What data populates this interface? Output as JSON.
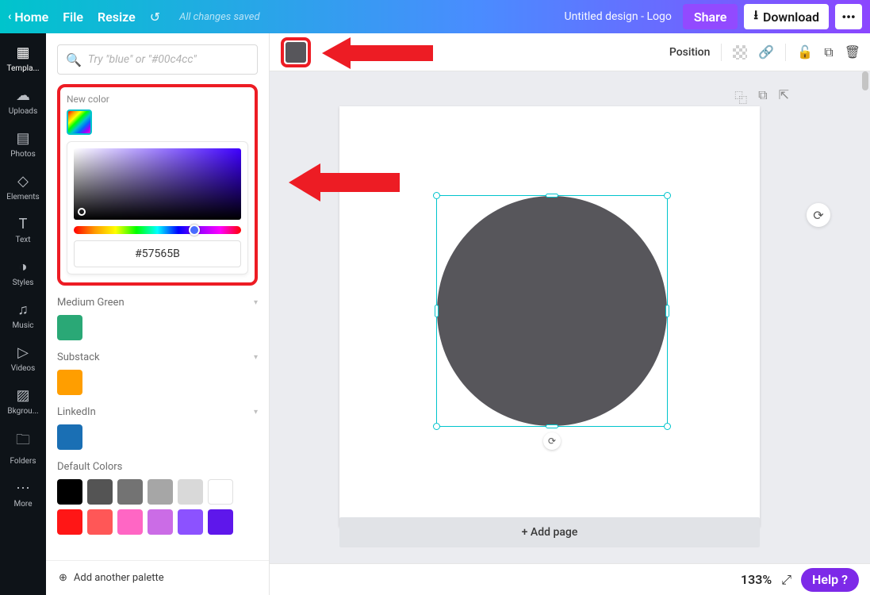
{
  "topbar": {
    "home": "Home",
    "file": "File",
    "resize": "Resize",
    "status": "All changes saved",
    "title": "Untitled design - Logo",
    "share": "Share",
    "download": "Download",
    "more": "•••"
  },
  "rail": {
    "items": [
      {
        "icon": "▦",
        "label": "Templa..."
      },
      {
        "icon": "☁",
        "label": "Uploads"
      },
      {
        "icon": "▤",
        "label": "Photos"
      },
      {
        "icon": "◇",
        "label": "Elements"
      },
      {
        "icon": "T",
        "label": "Text"
      },
      {
        "icon": "◑",
        "label": "Styles"
      },
      {
        "icon": "♫",
        "label": "Music"
      },
      {
        "icon": "▷",
        "label": "Videos"
      },
      {
        "icon": "▨",
        "label": "Bkgrou..."
      },
      {
        "icon": "🗀",
        "label": "Folders"
      },
      {
        "icon": "⋯",
        "label": "More"
      }
    ]
  },
  "panel": {
    "search_placeholder": "Try \"blue\" or \"#00c4cc\"",
    "new_color_label": "New color",
    "hex_value": "#57565B",
    "palettes": [
      {
        "title": "Medium Green",
        "colors": [
          "#2aa876"
        ]
      },
      {
        "title": "Substack",
        "colors": [
          "#ff9e00"
        ]
      },
      {
        "title": "LinkedIn",
        "colors": [
          "#1a6fb4"
        ]
      }
    ],
    "default_title": "Default Colors",
    "default_colors_row1": [
      "#000000",
      "#545454",
      "#737373",
      "#a6a6a6",
      "#d9d9d9",
      "#ffffff"
    ],
    "default_colors_row2": [
      "#ff1616",
      "#ff5757",
      "#ff66c4",
      "#cb6ce6",
      "#8c52ff",
      "#5e17eb"
    ],
    "add_palette": "Add another palette"
  },
  "context": {
    "selected_color": "#57565B",
    "position": "Position"
  },
  "stage": {
    "add_page": "+ Add page"
  },
  "footer": {
    "zoom": "133%",
    "help": "Help"
  }
}
